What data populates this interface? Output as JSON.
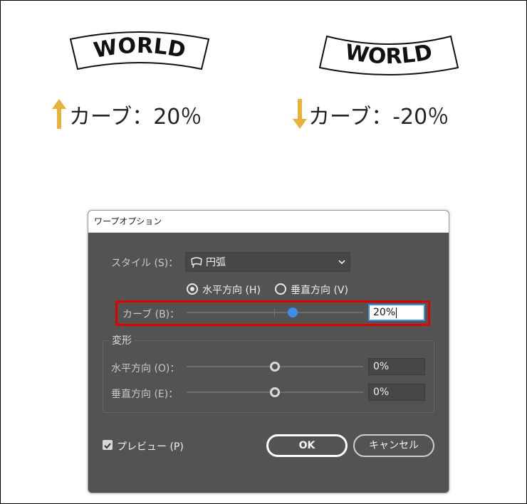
{
  "examples": [
    {
      "banner_text": "WORLD",
      "caption": "カーブ：20％",
      "arrow_direction": "up"
    },
    {
      "banner_text": "WORLD",
      "caption": "カーブ：-20％",
      "arrow_direction": "down"
    }
  ],
  "colors": {
    "arrow": "#e6b23a",
    "dialog_bg": "#535353",
    "highlight": "#e00000",
    "slider_thumb": "#3d8ee8"
  },
  "dialog": {
    "title": "ワープオプション",
    "style": {
      "label": "スタイル (S)：",
      "selected": "円弧",
      "icon": "arc-icon"
    },
    "orientation": {
      "horizontal_label": "水平方向 (H)",
      "vertical_label": "垂直方向 (V)",
      "selected": "horizontal"
    },
    "bend": {
      "label": "カーブ (B)：",
      "value": "20%",
      "value_fraction": 0.6
    },
    "distortion": {
      "title": "変形",
      "horizontal": {
        "label": "水平方向 (O)：",
        "value": "0%",
        "value_fraction": 0.5
      },
      "vertical": {
        "label": "垂直方向 (E)：",
        "value": "0%",
        "value_fraction": 0.5
      }
    },
    "preview": {
      "label": "プレビュー (P)",
      "checked": true
    },
    "buttons": {
      "ok": "OK",
      "cancel": "キャンセル"
    }
  }
}
